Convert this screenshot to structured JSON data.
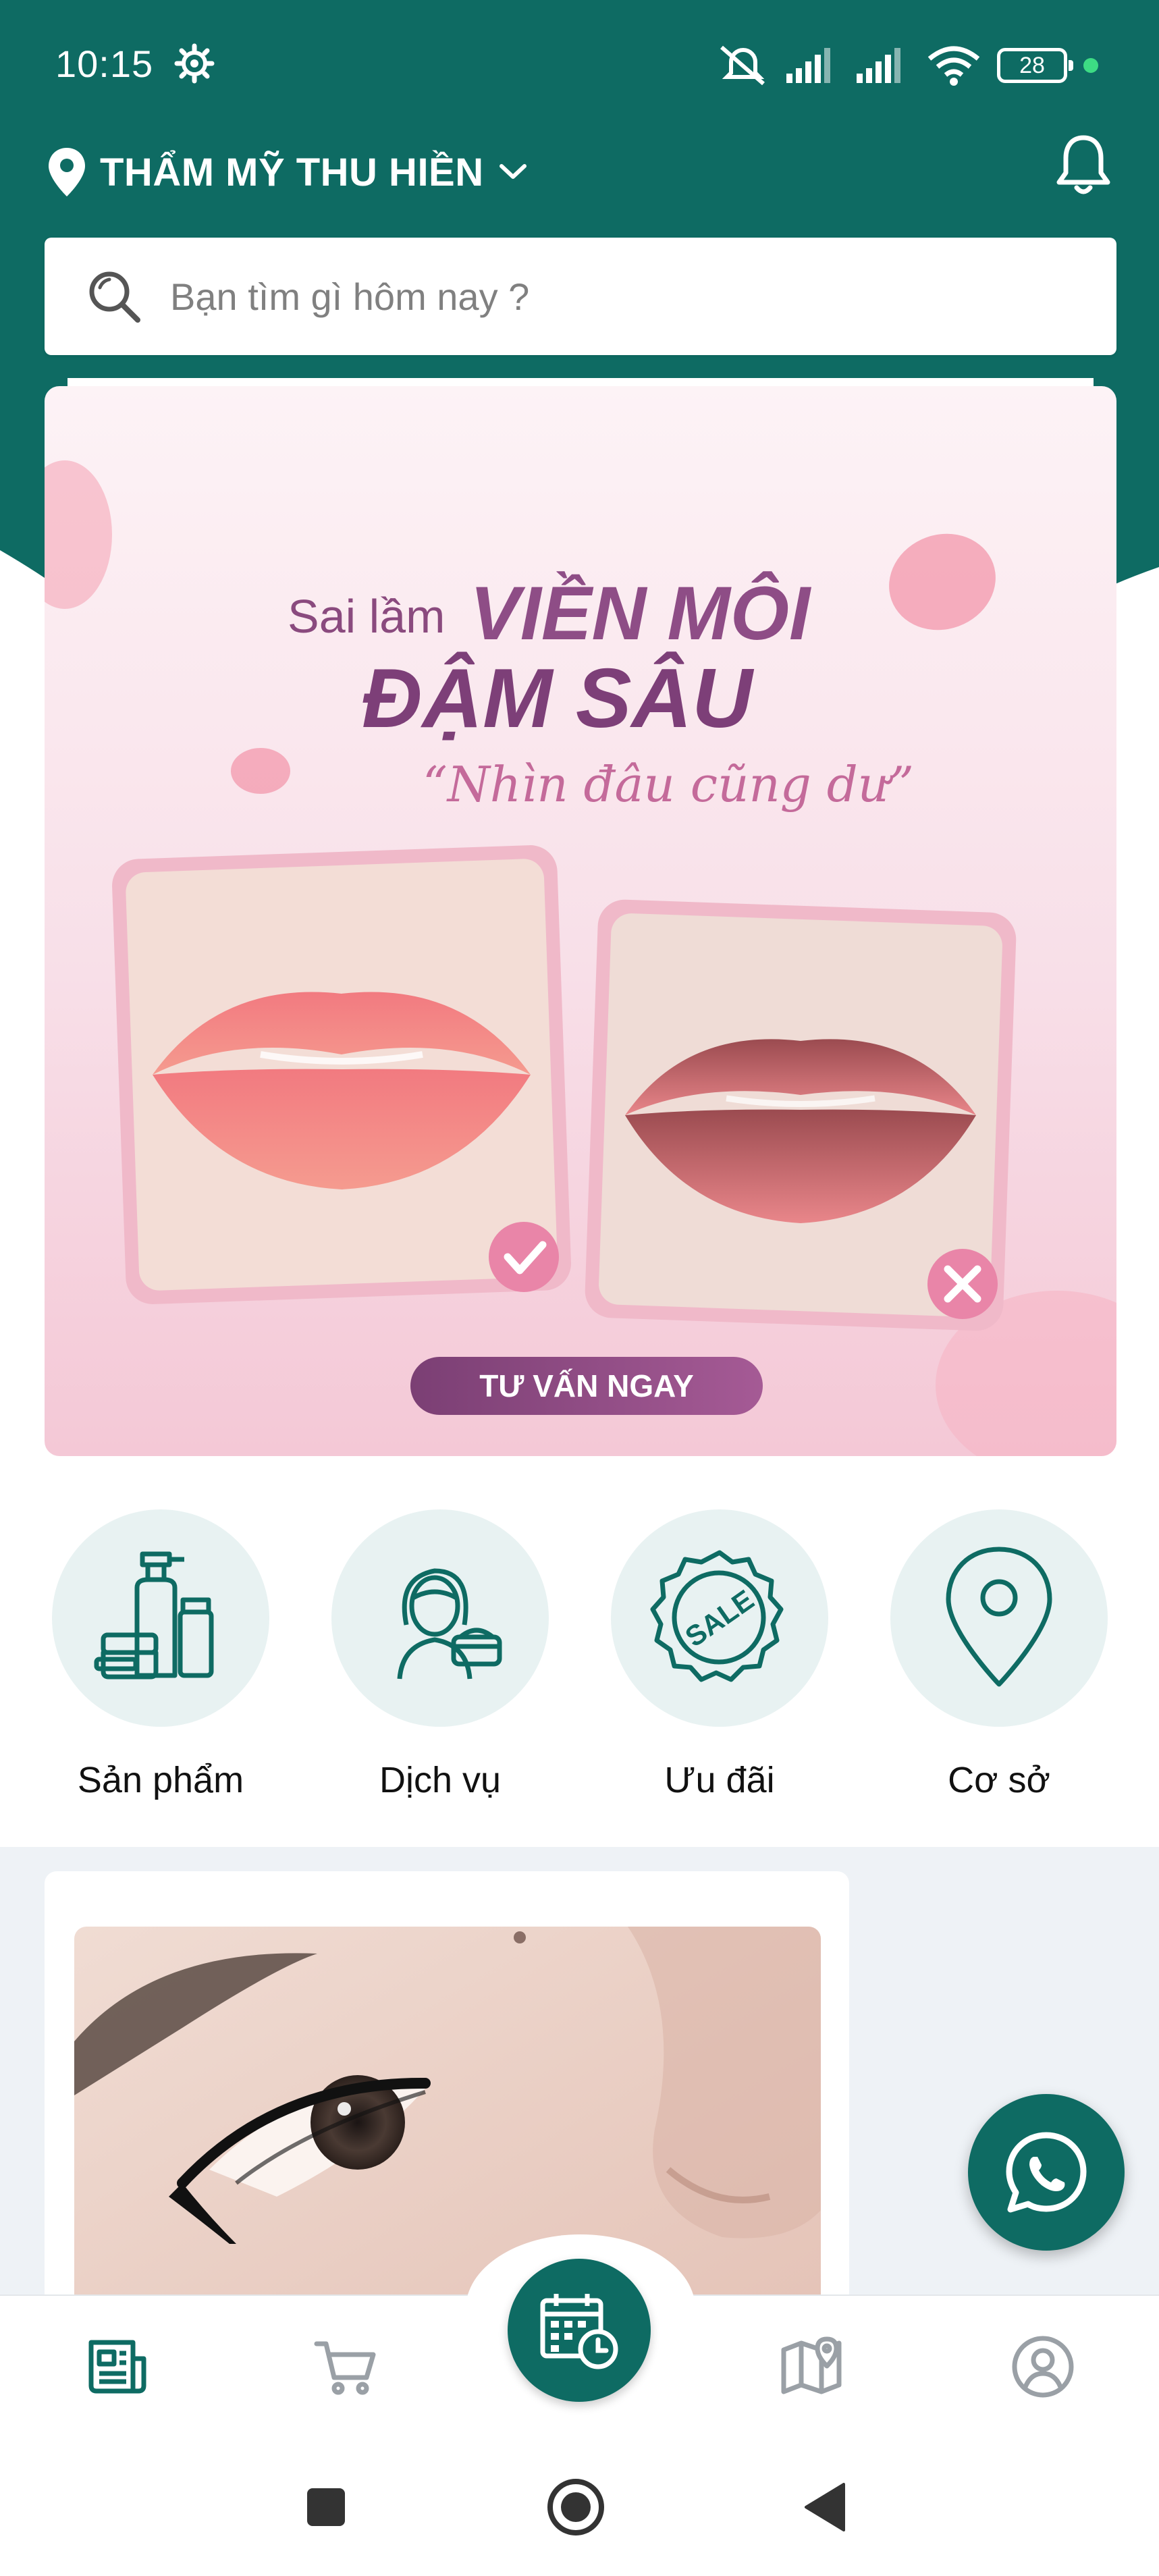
{
  "status_bar": {
    "time": "10:15",
    "battery": "28"
  },
  "header": {
    "location_name": "THẨM MỸ THU HIỀN"
  },
  "search": {
    "placeholder": "Bạn tìm gì hôm nay ?"
  },
  "banner": {
    "line1_small": "Sai lầm",
    "line1_big": "VIỀN MÔI",
    "line2_big": "ĐẬM SÂU",
    "tagline": "“Nhìn đâu cũng dư”",
    "cta": "TƯ VẤN NGAY"
  },
  "categories": [
    {
      "label": "Sản phẩm",
      "icon": "cosmetics-icon"
    },
    {
      "label": "Dịch vụ",
      "icon": "service-woman-icon"
    },
    {
      "label": "Ưu đãi",
      "icon": "sale-badge-icon"
    },
    {
      "label": "Cơ sở",
      "icon": "map-pin-icon"
    }
  ],
  "bottom_nav": [
    "news-icon",
    "cart-icon",
    "booking-calendar-icon",
    "map-icon",
    "account-icon"
  ],
  "colors": {
    "primary": "#0e6b63",
    "banner_pink": "#f7d6df",
    "category_bg": "#e8f2f2",
    "feed_bg": "#eef2f6"
  }
}
